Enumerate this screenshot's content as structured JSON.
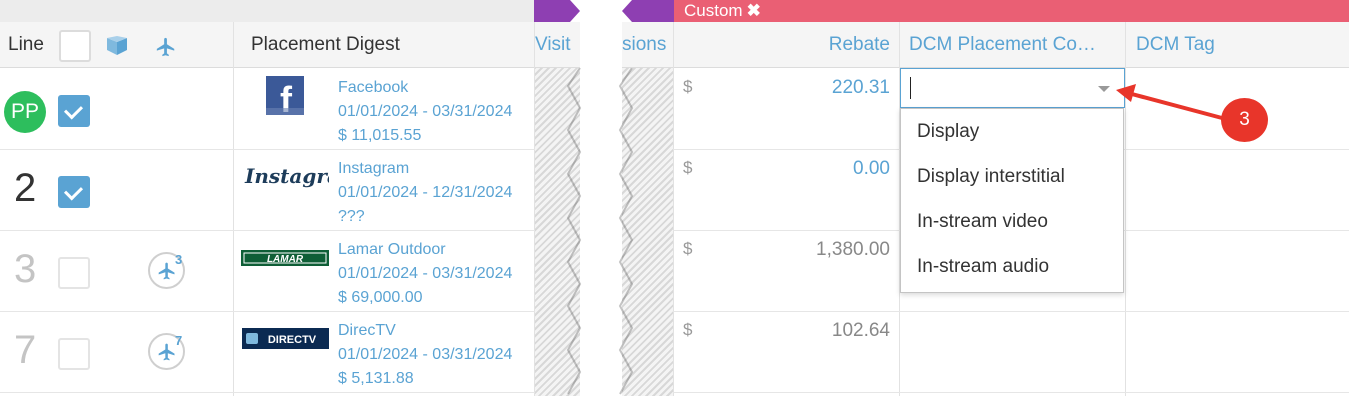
{
  "banner": {
    "custom_label": "Custom",
    "close_glyph": "✖"
  },
  "header": {
    "line": "Line",
    "placement_digest": "Placement Digest",
    "visit_partial": "Visit",
    "sions_partial": "sions",
    "rebate": "Rebate",
    "dcm_placement": "DCM Placement Co…",
    "dcm_tag": "DCM Tag",
    "icons": [
      "box-icon",
      "plane-icon"
    ]
  },
  "rows": [
    {
      "line": "",
      "avatar": "PP",
      "checked": true,
      "logo": "Facebook",
      "name": "Facebook",
      "dates": "01/01/2024 - 03/31/2024",
      "amount": "$ 11,015.55",
      "currency": "$",
      "rebate": "220.31",
      "rebate_style": "link"
    },
    {
      "line": "2",
      "checked": true,
      "logo": "Instagram",
      "name": "Instagram",
      "dates": "01/01/2024 - 12/31/2024",
      "amount": "???",
      "currency": "$",
      "rebate": "0.00",
      "rebate_style": "link"
    },
    {
      "line": "3",
      "checked": false,
      "plane_count": "3",
      "logo": "LAMAR",
      "name": "Lamar Outdoor",
      "dates": "01/01/2024 - 03/31/2024",
      "amount": "$ 69,000.00",
      "currency": "$",
      "rebate": "1,380.00",
      "rebate_style": "gray"
    },
    {
      "line": "7",
      "checked": false,
      "plane_count": "7",
      "logo": "DIRECTV",
      "name": "DirecTV",
      "dates": "01/01/2024 - 03/31/2024",
      "amount": "$ 5,131.88",
      "currency": "$",
      "rebate": "102.64",
      "rebate_style": "gray"
    }
  ],
  "dropdown": {
    "value": "",
    "options": [
      "Display",
      "Display interstitial",
      "In-stream video",
      "In-stream audio"
    ]
  },
  "annotation": {
    "badge": "3"
  },
  "colors": {
    "accent": "#5aa3d3",
    "banner": "#ea5f74",
    "purple": "#8e3fb2",
    "badge": "#e8352a",
    "avatar": "#2dbe5d"
  }
}
